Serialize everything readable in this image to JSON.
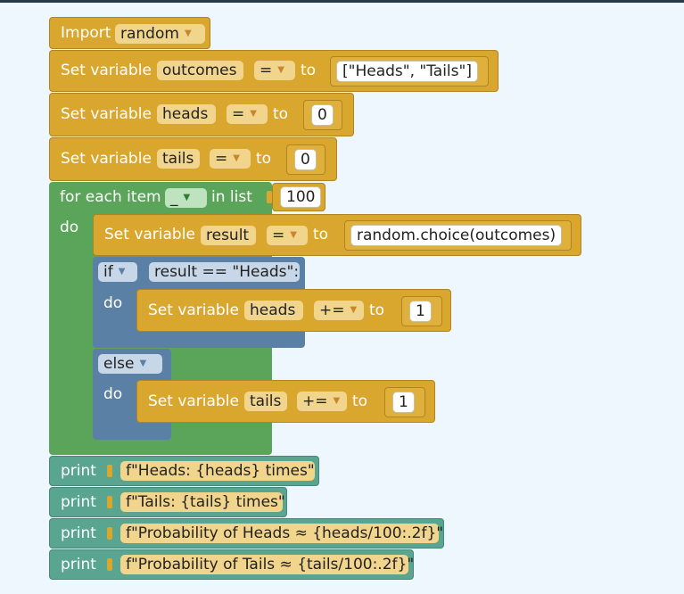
{
  "blocks": {
    "import": {
      "label": "Import",
      "module": "random"
    },
    "set_outcomes": {
      "label": "Set variable",
      "var": "outcomes",
      "op": "=",
      "to": "to",
      "value": "[\"Heads\", \"Tails\"]"
    },
    "set_heads": {
      "label": "Set variable",
      "var": "heads",
      "op": "=",
      "to": "to",
      "value": "0"
    },
    "set_tails": {
      "label": "Set variable",
      "var": "tails",
      "op": "=",
      "to": "to",
      "value": "0"
    },
    "for_each": {
      "label": "for each item",
      "var": "_",
      "in_list": "in list",
      "value": "100",
      "do": "do"
    },
    "set_result": {
      "label": "Set variable",
      "var": "result",
      "op": "=",
      "to": "to",
      "value": "random.choice(outcomes)"
    },
    "if": {
      "label": "if",
      "condition": "result == \"Heads\":",
      "do": "do"
    },
    "inc_heads": {
      "label": "Set variable",
      "var": "heads",
      "op": "+=",
      "to": "to",
      "value": "1"
    },
    "else": {
      "label": "else",
      "do": "do"
    },
    "inc_tails": {
      "label": "Set variable",
      "var": "tails",
      "op": "+=",
      "to": "to",
      "value": "1"
    },
    "prints": [
      {
        "label": "print",
        "value": "f\"Heads: {heads} times\""
      },
      {
        "label": "print",
        "value": "f\"Tails: {tails} times\""
      },
      {
        "label": "print",
        "value": "f\"Probability of Heads ≈ {heads/100:.2f}\""
      },
      {
        "label": "print",
        "value": "f\"Probability of Tails ≈ {tails/100:.2f}\""
      }
    ]
  },
  "colors": {
    "variables": "#d9a72e",
    "logic": "#5b80a5",
    "loops": "#5ba55b",
    "text": "#5aa58f",
    "workspace": "#eef7fd"
  },
  "icons": {
    "dropdown": "dropdown-arrow-icon"
  }
}
